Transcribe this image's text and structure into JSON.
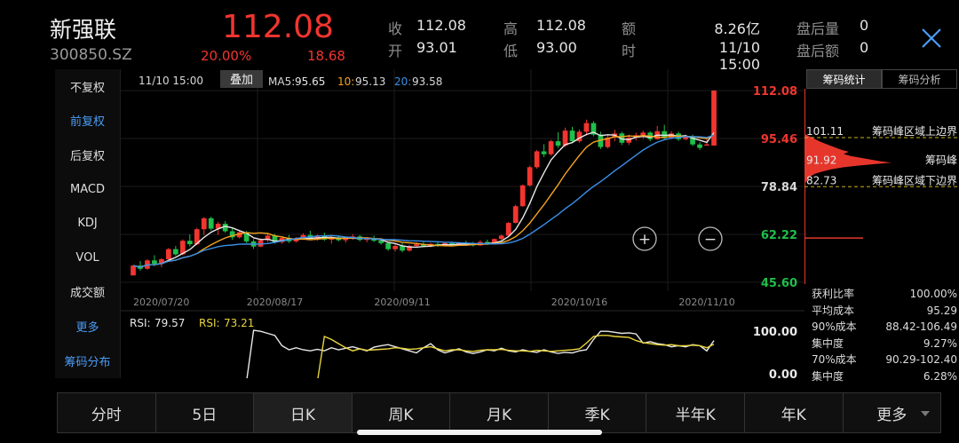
{
  "stock": {
    "name": "新强联",
    "code": "300850.SZ",
    "price": "112.08",
    "change_pct": "20.00%",
    "change": "18.68"
  },
  "quote": {
    "close_label": "收",
    "close": "112.08",
    "open_label": "开",
    "open": "93.01",
    "high_label": "高",
    "high": "112.08",
    "low_label": "低",
    "low": "93.00",
    "amount_label": "额",
    "amount": "8.26亿",
    "time_label": "时",
    "time": "11/10 15:00",
    "after_vol_label": "盘后量",
    "after_vol": "0",
    "after_amt_label": "盘后额",
    "after_amt": "0"
  },
  "left_menu": [
    {
      "label": "不复权",
      "state": "normal"
    },
    {
      "label": "前复权",
      "state": "active"
    },
    {
      "label": "后复权",
      "state": "normal"
    },
    {
      "label": "MACD",
      "state": "normal"
    },
    {
      "label": "KDJ",
      "state": "normal"
    },
    {
      "label": "VOL",
      "state": "normal"
    },
    {
      "label": "成交额",
      "state": "normal"
    },
    {
      "label": "更多",
      "state": "blue"
    },
    {
      "label": "筹码分布",
      "state": "blue"
    }
  ],
  "chart_header": {
    "time": "11/10 15:00",
    "overlay_label": "叠加",
    "ma5_label": "MA5:",
    "ma5": "95.65",
    "ma10_label": "10:",
    "ma10": "95.13",
    "ma20_label": "20:",
    "ma20": "93.58"
  },
  "zoom": {
    "in": "+",
    "out": "−"
  },
  "colors": {
    "up": "#f2352f",
    "down": "#1fbf4a",
    "ma5": "#e8e8e8",
    "ma10": "#f4a41e",
    "ma20": "#3a8fe8",
    "rsi1": "#e8e8e8",
    "rsi2": "#e8d43c",
    "blue": "#4a9cf5"
  },
  "chart_data": {
    "type": "candlestick",
    "price_axis": [
      "112.08",
      "95.46",
      "78.84",
      "62.22",
      "45.60"
    ],
    "ylim": [
      45.6,
      112.08
    ],
    "dates": [
      "2020/07/20",
      "2020/08/17",
      "2020/09/11",
      "2020/10/16",
      "2020/11/10"
    ],
    "date_index": [
      0,
      20,
      38,
      63,
      81
    ],
    "ohlc": [
      [
        48.0,
        51.4,
        47.9,
        51.4
      ],
      [
        51.4,
        53.0,
        49.6,
        50.3
      ],
      [
        50.3,
        53.6,
        50.0,
        53.2
      ],
      [
        53.2,
        55.0,
        51.2,
        52.0
      ],
      [
        52.0,
        54.0,
        50.8,
        53.6
      ],
      [
        53.6,
        57.5,
        53.2,
        57.1
      ],
      [
        57.1,
        58.2,
        54.8,
        55.3
      ],
      [
        55.3,
        60.5,
        55.0,
        60.0
      ],
      [
        60.0,
        62.2,
        58.0,
        58.8
      ],
      [
        58.8,
        64.5,
        58.5,
        64.0
      ],
      [
        64.0,
        68.2,
        62.0,
        67.8
      ],
      [
        67.8,
        68.4,
        63.5,
        64.2
      ],
      [
        64.2,
        66.6,
        62.0,
        65.9
      ],
      [
        65.9,
        66.8,
        62.8,
        63.3
      ],
      [
        63.3,
        64.5,
        60.3,
        61.2
      ],
      [
        61.2,
        63.8,
        60.8,
        63.0
      ],
      [
        63.0,
        63.4,
        59.2,
        59.8
      ],
      [
        59.8,
        60.6,
        57.2,
        58.0
      ],
      [
        58.0,
        60.8,
        57.8,
        60.2
      ],
      [
        60.2,
        62.5,
        59.6,
        61.8
      ],
      [
        61.8,
        62.4,
        59.0,
        59.5
      ],
      [
        59.5,
        61.5,
        59.0,
        61.0
      ],
      [
        61.0,
        62.0,
        59.2,
        59.8
      ],
      [
        59.8,
        61.3,
        59.4,
        60.9
      ],
      [
        60.9,
        62.6,
        60.5,
        62.0
      ],
      [
        62.0,
        63.5,
        60.2,
        60.6
      ],
      [
        60.6,
        62.2,
        60.0,
        61.8
      ],
      [
        61.8,
        62.8,
        60.0,
        60.4
      ],
      [
        60.4,
        61.5,
        59.0,
        61.2
      ],
      [
        61.2,
        61.9,
        59.8,
        60.2
      ],
      [
        60.2,
        61.3,
        59.3,
        61.0
      ],
      [
        61.0,
        62.3,
        60.4,
        61.5
      ],
      [
        61.5,
        62.0,
        59.8,
        60.3
      ],
      [
        60.3,
        61.2,
        59.5,
        60.8
      ],
      [
        60.8,
        61.8,
        59.6,
        60.0
      ],
      [
        60.0,
        60.9,
        58.6,
        59.2
      ],
      [
        59.2,
        59.6,
        56.5,
        57.1
      ],
      [
        57.1,
        58.8,
        56.3,
        58.2
      ],
      [
        58.2,
        59.2,
        56.0,
        56.6
      ],
      [
        56.6,
        58.6,
        56.2,
        58.2
      ],
      [
        58.2,
        59.5,
        57.5,
        58.8
      ],
      [
        58.8,
        59.7,
        57.8,
        58.2
      ],
      [
        58.2,
        59.3,
        57.8,
        58.9
      ],
      [
        58.9,
        59.5,
        57.9,
        58.3
      ],
      [
        58.3,
        59.6,
        58.0,
        59.2
      ],
      [
        59.2,
        59.8,
        58.2,
        58.5
      ],
      [
        58.5,
        59.6,
        58.2,
        59.3
      ],
      [
        59.3,
        60.0,
        58.4,
        58.8
      ],
      [
        58.8,
        59.6,
        58.0,
        58.4
      ],
      [
        58.4,
        60.2,
        58.2,
        59.6
      ],
      [
        59.6,
        60.4,
        58.8,
        59.0
      ],
      [
        59.0,
        60.8,
        58.8,
        60.6
      ],
      [
        60.6,
        62.2,
        60.2,
        61.8
      ],
      [
        61.8,
        66.5,
        61.5,
        66.2
      ],
      [
        66.2,
        72.5,
        66.0,
        72.0
      ],
      [
        72.0,
        79.5,
        71.8,
        79.2
      ],
      [
        79.2,
        86.0,
        78.8,
        85.5
      ],
      [
        85.5,
        91.5,
        85.0,
        91.0
      ],
      [
        91.0,
        93.5,
        89.0,
        90.0
      ],
      [
        90.0,
        95.0,
        89.5,
        94.5
      ],
      [
        94.5,
        97.6,
        92.2,
        93.0
      ],
      [
        93.0,
        99.2,
        92.5,
        98.2
      ],
      [
        98.2,
        99.5,
        93.8,
        94.5
      ],
      [
        94.5,
        98.6,
        94.0,
        97.8
      ],
      [
        97.8,
        102.0,
        96.5,
        100.8
      ],
      [
        100.8,
        101.5,
        96.2,
        96.8
      ],
      [
        96.8,
        97.8,
        91.8,
        92.5
      ],
      [
        92.5,
        96.5,
        92.0,
        95.8
      ],
      [
        95.8,
        98.5,
        94.5,
        97.2
      ],
      [
        97.2,
        97.8,
        93.2,
        94.0
      ],
      [
        94.0,
        96.8,
        93.2,
        95.8
      ],
      [
        95.8,
        97.5,
        94.8,
        96.6
      ],
      [
        96.6,
        98.2,
        95.4,
        97.5
      ],
      [
        97.5,
        98.0,
        94.5,
        95.2
      ],
      [
        95.2,
        99.8,
        95.0,
        98.0
      ],
      [
        98.0,
        100.2,
        95.0,
        95.6
      ],
      [
        95.6,
        98.0,
        95.2,
        97.2
      ],
      [
        97.2,
        97.8,
        94.6,
        95.2
      ],
      [
        95.2,
        96.8,
        94.8,
        96.3
      ],
      [
        96.3,
        96.8,
        92.8,
        93.4
      ],
      [
        93.4,
        94.2,
        91.5,
        92.2
      ],
      [
        93.0,
        95.6,
        93.0,
        93.4
      ],
      [
        93.01,
        112.08,
        93.0,
        112.08
      ]
    ],
    "rsi": {
      "label1": "RSI:",
      "value1": "79.57",
      "label2": "RSI:",
      "value2": "73.21",
      "axis": [
        "100.00",
        "0.00"
      ],
      "series1": [
        0,
        0,
        0,
        0,
        0,
        0,
        0,
        0,
        0,
        0,
        0,
        0,
        0,
        0,
        0,
        0,
        0,
        100,
        98,
        94,
        90,
        70,
        62,
        66,
        62,
        60,
        63,
        60,
        66,
        62,
        65,
        68,
        64,
        60,
        67,
        70,
        72,
        68,
        64,
        60,
        56,
        66,
        74,
        62,
        56,
        60,
        64,
        58,
        55,
        58,
        62,
        60,
        65,
        60,
        58,
        62,
        59,
        57,
        62,
        58,
        55,
        57,
        56,
        60,
        62,
        82,
        98,
        98,
        96,
        94,
        95,
        93,
        75,
        78,
        74,
        72,
        68,
        70,
        68,
        72,
        70,
        60,
        80
      ],
      "series2": [
        0,
        0,
        0,
        0,
        0,
        0,
        0,
        0,
        0,
        0,
        0,
        0,
        0,
        0,
        0,
        0,
        0,
        0,
        0,
        0,
        0,
        0,
        0,
        0,
        0,
        0,
        0,
        88,
        82,
        74,
        66,
        60,
        64,
        61,
        62,
        63,
        64,
        66,
        65,
        63,
        64,
        66,
        68,
        64,
        60,
        62,
        62,
        60,
        59,
        61,
        62,
        62,
        63,
        61,
        60,
        60,
        59,
        61,
        60,
        59,
        60,
        61,
        62,
        64,
        75,
        88,
        90,
        90,
        88,
        87,
        86,
        80,
        76,
        74,
        72,
        71,
        72,
        70,
        70,
        71,
        70,
        66,
        73
      ]
    }
  },
  "chip": {
    "tabs": [
      "筹码统计",
      "筹码分析"
    ],
    "upper_price": "101.11",
    "upper_label": "筹码峰区域上边界",
    "peak_price": "91.92",
    "peak_label": "筹码峰",
    "lower_price": "82.73",
    "lower_label": "筹码峰区域下边界",
    "stats": [
      {
        "label": "获利比率",
        "value": "100.00%"
      },
      {
        "label": "平均成本",
        "value": "95.29"
      },
      {
        "label": "90%成本",
        "value": "88.42-106.49"
      },
      {
        "label": "集中度",
        "value": "9.27%"
      },
      {
        "label": "70%成本",
        "value": "90.29-102.40"
      },
      {
        "label": "集中度",
        "value": "6.28%"
      }
    ]
  },
  "bottom_tabs": [
    {
      "label": "分时",
      "active": false
    },
    {
      "label": "5日",
      "active": false
    },
    {
      "label": "日K",
      "active": true
    },
    {
      "label": "周K",
      "active": false
    },
    {
      "label": "月K",
      "active": false
    },
    {
      "label": "季K",
      "active": false
    },
    {
      "label": "半年K",
      "active": false
    },
    {
      "label": "年K",
      "active": false
    },
    {
      "label": "更多",
      "active": false
    }
  ]
}
